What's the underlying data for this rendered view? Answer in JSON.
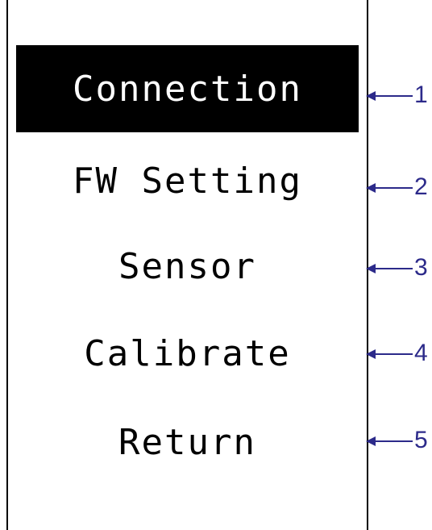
{
  "menu": {
    "items": [
      {
        "label": "Connection",
        "selected": true
      },
      {
        "label": "FW Setting",
        "selected": false
      },
      {
        "label": "Sensor",
        "selected": false
      },
      {
        "label": "Calibrate",
        "selected": false
      },
      {
        "label": "Return",
        "selected": false
      }
    ]
  },
  "callouts": [
    "1",
    "2",
    "3",
    "4",
    "5"
  ],
  "colors": {
    "screen_border": "#000000",
    "selected_bg": "#000000",
    "selected_text": "#ffffff",
    "text": "#000000",
    "callout": "#2c2a8a"
  }
}
